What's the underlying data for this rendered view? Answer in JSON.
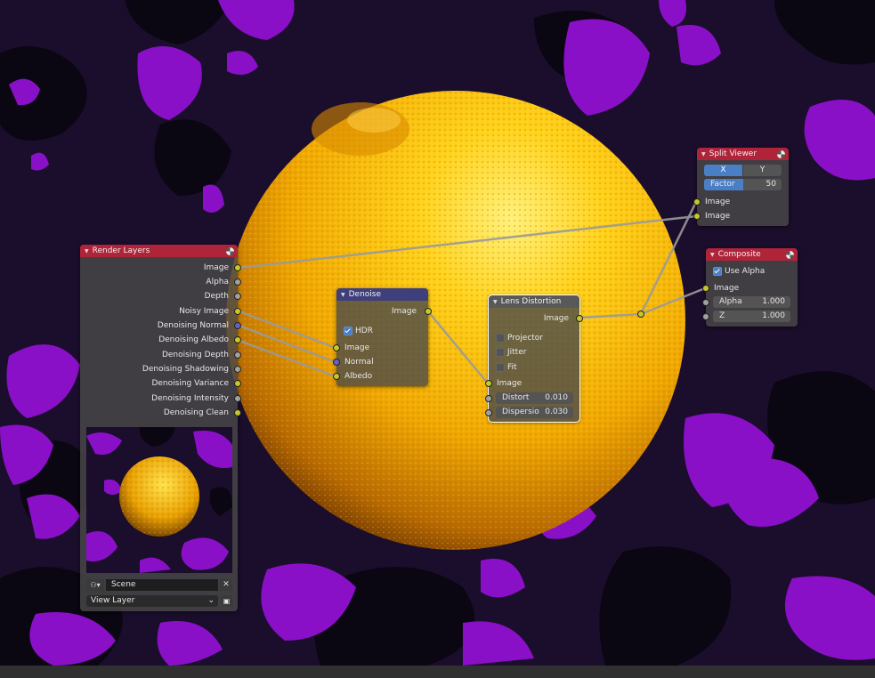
{
  "render_layers": {
    "title": "Render Layers",
    "outputs": [
      "Image",
      "Alpha",
      "Depth",
      "Noisy Image",
      "Denoising Normal",
      "Denoising Albedo",
      "Denoising Depth",
      "Denoising Shadowing",
      "Denoising Variance",
      "Denoising Intensity",
      "Denoising Clean"
    ],
    "scene": "Scene",
    "view_layer": "View Layer"
  },
  "denoise": {
    "title": "Denoise",
    "output": "Image",
    "hdr_label": "HDR",
    "hdr_checked": true,
    "inputs": [
      "Image",
      "Normal",
      "Albedo"
    ]
  },
  "lens_distortion": {
    "title": "Lens Distortion",
    "output": "Image",
    "options": [
      "Projector",
      "Jitter",
      "Fit"
    ],
    "input": "Image",
    "distort_label": "Distort",
    "distort_value": "0.010",
    "dispersion_label": "Dispersio",
    "dispersion_value": "0.030"
  },
  "split_viewer": {
    "title": "Split Viewer",
    "x_label": "X",
    "y_label": "Y",
    "factor_label": "Factor",
    "factor_value": "50",
    "factor_level": 0.5,
    "inputs": [
      "Image",
      "Image"
    ]
  },
  "composite": {
    "title": "Composite",
    "use_alpha_label": "Use Alpha",
    "use_alpha_checked": true,
    "input": "Image",
    "alpha_label": "Alpha",
    "alpha_value": "1.000",
    "z_label": "Z",
    "z_value": "1.000"
  },
  "colors": {
    "background": "#1b0d2c",
    "purple_blotch": "#8a10c8",
    "orange": "#f0b000",
    "output_node_header": "#b0243a",
    "filter_node_header": "#3f3f7c",
    "distort_node_header": "#595959",
    "socket_color": "#c7c729",
    "socket_value": "#a1a1a1",
    "socket_vector": "#6363c7"
  }
}
